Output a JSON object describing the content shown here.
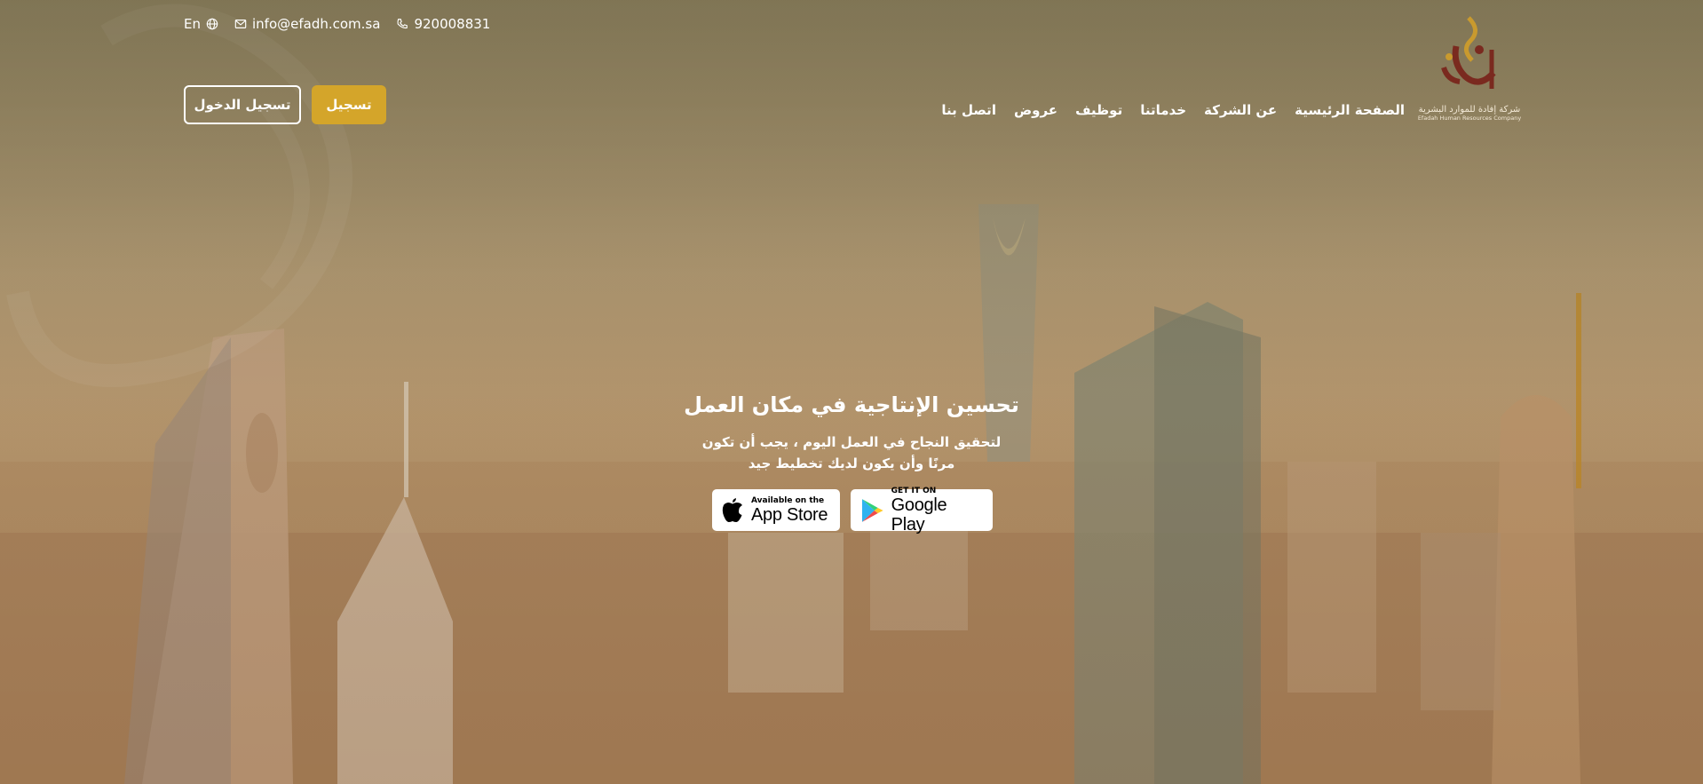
{
  "contact": {
    "language": "En",
    "email": "info@efadh.com.sa",
    "phone": "920008831"
  },
  "auth": {
    "register_label": "تسجيل",
    "login_label": "تسجيل الدخول"
  },
  "nav": {
    "items": [
      "الصفحة الرئيسية",
      "عن الشركة",
      "خدماتنا",
      "توظيف",
      "عروض",
      "اتصل بنا"
    ]
  },
  "logo": {
    "mark": "إفادة",
    "subtitle_ar": "شركة إفادة للموارد البشرية",
    "subtitle_en": "Efadah Human Resources Company"
  },
  "hero": {
    "title": "تحسين الإنتاجية في مكان العمل",
    "subtitle_line1": "لتحقيق النجاح في العمل اليوم ، يجب أن تكون",
    "subtitle_line2": "مرنًا وأن يكون لديك تخطيط جيد"
  },
  "stores": {
    "app_small": "Available on the",
    "app_big": "App Store",
    "play_small": "GET IT ON",
    "play_big": "Google Play"
  },
  "colors": {
    "accent": "#d4a52a",
    "logo_maroon": "#7a2a1f"
  },
  "icons": [
    "globe-icon",
    "mail-icon",
    "phone-icon",
    "apple-icon",
    "google-play-icon"
  ]
}
